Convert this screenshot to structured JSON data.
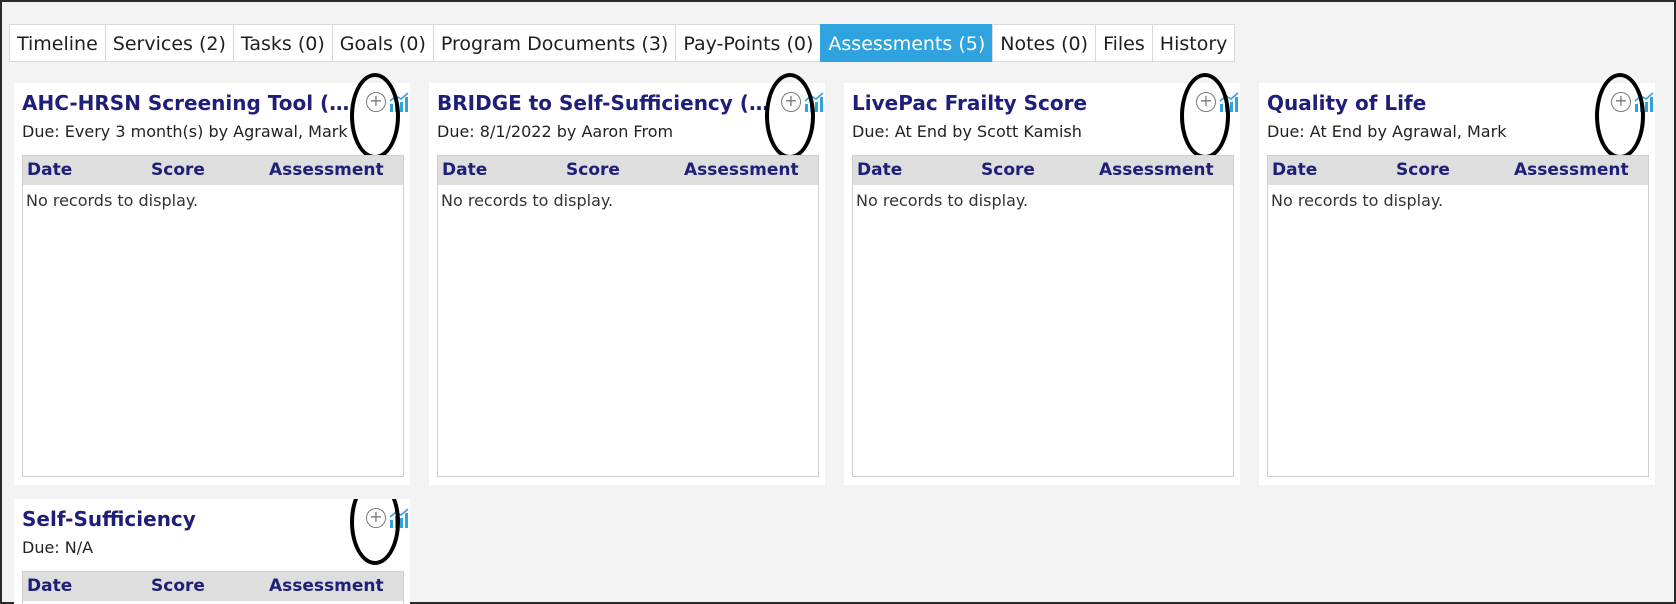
{
  "tabs": [
    {
      "label": "Timeline",
      "active": false
    },
    {
      "label": "Services (2)",
      "active": false
    },
    {
      "label": "Tasks (0)",
      "active": false
    },
    {
      "label": "Goals (0)",
      "active": false
    },
    {
      "label": "Program Documents (3)",
      "active": false
    },
    {
      "label": "Pay-Points (0)",
      "active": false
    },
    {
      "label": "Assessments (5)",
      "active": true
    },
    {
      "label": "Notes (0)",
      "active": false
    },
    {
      "label": "Files",
      "active": false
    },
    {
      "label": "History",
      "active": false
    }
  ],
  "grid_columns": {
    "date": "Date",
    "score": "Score",
    "assessment": "Assessment"
  },
  "empty_text": "No records to display.",
  "cards": [
    {
      "title": "AHC-HRSN Screening Tool (CMS/…",
      "due": "Due: Every 3 month(s) by Agrawal, Mark"
    },
    {
      "title": "BRIDGE to Self-Sufficiency (EMPa…",
      "due": "Due: 8/1/2022 by Aaron From"
    },
    {
      "title": "LivePac Frailty Score",
      "due": "Due: At End by Scott Kamish"
    },
    {
      "title": "Quality of Life",
      "due": "Due: At End by Agrawal, Mark"
    },
    {
      "title": "Self-Sufficiency",
      "due": "Due: N/A"
    }
  ],
  "icons": {
    "add": "add-circle-icon",
    "chart": "bar-chart-icon"
  },
  "colors": {
    "accent": "#2ea3e0",
    "title": "#1f1f7a",
    "chart_icon": "#2ea3e0"
  }
}
